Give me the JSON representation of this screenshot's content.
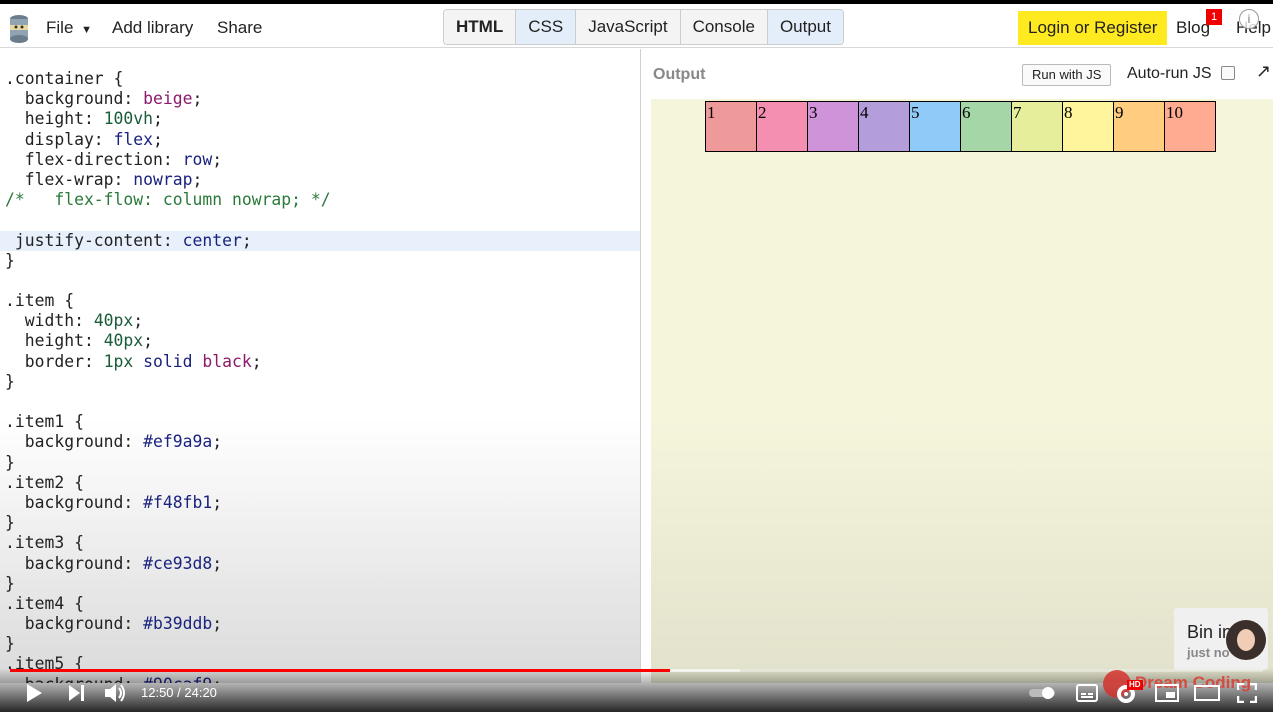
{
  "menu": {
    "file": "File",
    "add_library": "Add library",
    "share": "Share"
  },
  "tabs": [
    {
      "label": "HTML"
    },
    {
      "label": "CSS"
    },
    {
      "label": "JavaScript"
    },
    {
      "label": "Console"
    },
    {
      "label": "Output"
    }
  ],
  "auth": {
    "login": "Login or Register"
  },
  "nav": {
    "blog": "Blog",
    "blog_badge": "1",
    "help": "Help",
    "info": "i"
  },
  "code": {
    "lines": [
      [
        {
          "t": ".container {"
        }
      ],
      [
        {
          "t": "  background: "
        },
        {
          "t": "beige",
          "c": "kw"
        },
        {
          "t": ";"
        }
      ],
      [
        {
          "t": "  height: "
        },
        {
          "t": "100vh",
          "c": "num"
        },
        {
          "t": ";"
        }
      ],
      [
        {
          "t": "  display: "
        },
        {
          "t": "flex",
          "c": "str"
        },
        {
          "t": ";"
        }
      ],
      [
        {
          "t": "  flex-direction: "
        },
        {
          "t": "row",
          "c": "str"
        },
        {
          "t": ";"
        }
      ],
      [
        {
          "t": "  flex-wrap: "
        },
        {
          "t": "nowrap",
          "c": "str"
        },
        {
          "t": ";"
        }
      ],
      [
        {
          "t": "/*   flex-flow: column nowrap; */",
          "c": "cm"
        }
      ],
      [
        {
          "t": ""
        }
      ],
      [
        {
          "t": " justify-content: "
        },
        {
          "t": "center",
          "c": "str"
        },
        {
          "t": ";"
        }
      ],
      [
        {
          "t": "}"
        }
      ],
      [
        {
          "t": ""
        }
      ],
      [
        {
          "t": ".item {"
        }
      ],
      [
        {
          "t": "  width: "
        },
        {
          "t": "40px",
          "c": "num"
        },
        {
          "t": ";"
        }
      ],
      [
        {
          "t": "  height: "
        },
        {
          "t": "40px",
          "c": "num"
        },
        {
          "t": ";"
        }
      ],
      [
        {
          "t": "  border: "
        },
        {
          "t": "1px",
          "c": "num"
        },
        {
          "t": " solid ",
          "c": "str"
        },
        {
          "t": "black",
          "c": "kw"
        },
        {
          "t": ";"
        }
      ],
      [
        {
          "t": "}"
        }
      ],
      [
        {
          "t": ""
        }
      ],
      [
        {
          "t": ".item1 {"
        }
      ],
      [
        {
          "t": "  background: "
        },
        {
          "t": "#ef9a9a",
          "c": "str"
        },
        {
          "t": ";"
        }
      ],
      [
        {
          "t": "}"
        }
      ],
      [
        {
          "t": ".item2 {"
        }
      ],
      [
        {
          "t": "  background: "
        },
        {
          "t": "#f48fb1",
          "c": "str"
        },
        {
          "t": ";"
        }
      ],
      [
        {
          "t": "}"
        }
      ],
      [
        {
          "t": ".item3 {"
        }
      ],
      [
        {
          "t": "  background: "
        },
        {
          "t": "#ce93d8",
          "c": "str"
        },
        {
          "t": ";"
        }
      ],
      [
        {
          "t": "}"
        }
      ],
      [
        {
          "t": ".item4 {"
        }
      ],
      [
        {
          "t": "  background: "
        },
        {
          "t": "#b39ddb",
          "c": "str"
        },
        {
          "t": ";"
        }
      ],
      [
        {
          "t": "}"
        }
      ],
      [
        {
          "t": ".item5 {"
        }
      ],
      [
        {
          "t": "  background: "
        },
        {
          "t": "#90caf9",
          "c": "str"
        },
        {
          "t": ";"
        }
      ]
    ]
  },
  "output": {
    "title": "Output",
    "run_button": "Run with JS",
    "autorun": "Auto-run JS",
    "items": [
      {
        "label": "1",
        "color": "#ef9a9a"
      },
      {
        "label": "2",
        "color": "#f48fb1"
      },
      {
        "label": "3",
        "color": "#ce93d8"
      },
      {
        "label": "4",
        "color": "#b39ddb"
      },
      {
        "label": "5",
        "color": "#90caf9"
      },
      {
        "label": "6",
        "color": "#a5d6a7"
      },
      {
        "label": "7",
        "color": "#e6ee9c"
      },
      {
        "label": "8",
        "color": "#fff59d"
      },
      {
        "label": "9",
        "color": "#ffcc80"
      },
      {
        "label": "10",
        "color": "#ffab91"
      }
    ]
  },
  "overlay": {
    "name": "Bin in",
    "status": "just no"
  },
  "video": {
    "time": "12:50 / 24:20",
    "progress": 0.527,
    "buffered": 0.583,
    "brand": "Dream Coding",
    "quality": "HD"
  }
}
